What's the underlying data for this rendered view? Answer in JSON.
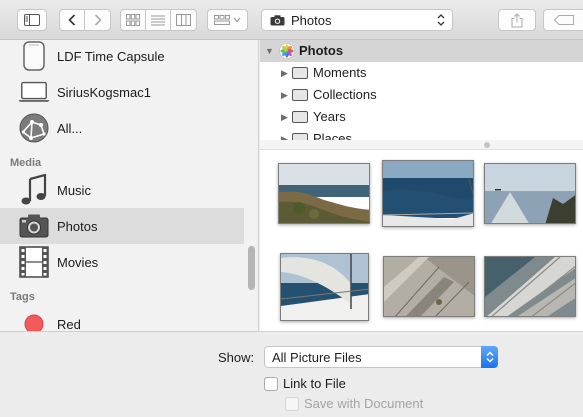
{
  "toolbar": {
    "location_label": "Photos",
    "icons": [
      "sidebar-toggle-icon",
      "back-icon",
      "forward-icon",
      "icon-view-icon",
      "list-view-icon",
      "column-view-icon",
      "arrange-icon",
      "camera-icon",
      "share-icon",
      "tag-icon"
    ]
  },
  "sidebar": {
    "devices": [
      {
        "label": "LDF  Time Capsule",
        "icon": "time-capsule-icon"
      },
      {
        "label": "SiriusKogsmac1",
        "icon": "laptop-icon"
      },
      {
        "label": "All...",
        "icon": "network-icon"
      }
    ],
    "media_header": "Media",
    "media": [
      {
        "label": "Music",
        "icon": "music-note-icon"
      },
      {
        "label": "Photos",
        "icon": "camera-icon",
        "selected": true
      },
      {
        "label": "Movies",
        "icon": "film-icon"
      }
    ],
    "tags_header": "Tags",
    "tags": [
      {
        "label": "Red",
        "color": "#f25b5b"
      }
    ]
  },
  "tree": {
    "root": "Photos",
    "children": [
      "Moments",
      "Collections",
      "Years",
      "Places"
    ]
  },
  "bottom": {
    "show_label": "Show:",
    "show_value": "All Picture Files",
    "link_label": "Link to File",
    "save_label": "Save with Document"
  },
  "colors": {
    "accent_blue": "#1b72ee",
    "selection_gray": "#dcdcdc",
    "tag_red": "#f25b5b"
  }
}
